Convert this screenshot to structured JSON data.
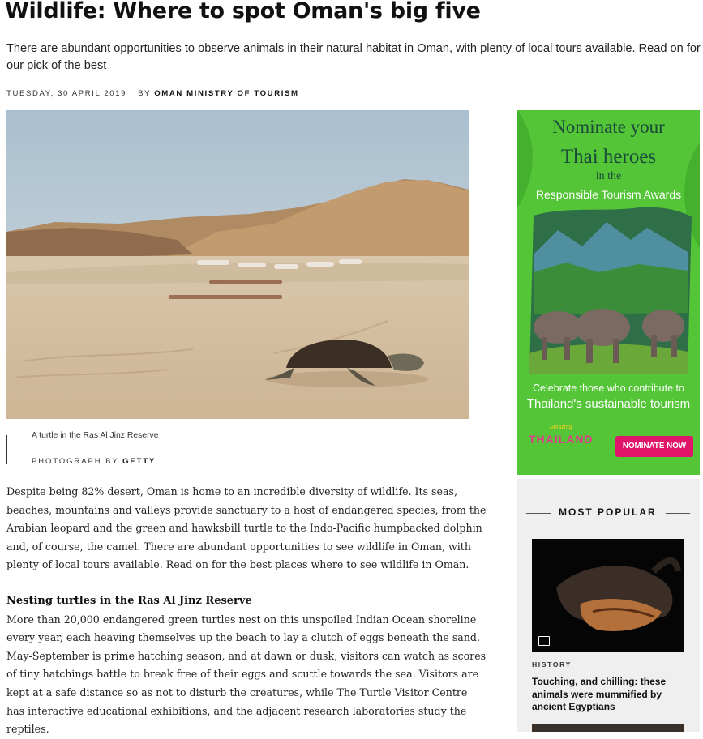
{
  "article": {
    "title": "Wildlife: Where to spot Oman's big five",
    "subtitle": "There are abundant opportunities to observe animals in their natural habitat in Oman, with plenty of local tours available. Read on for our pick of the best",
    "date": "TUESDAY, 30 APRIL 2019",
    "by_label": "BY",
    "author": "OMAN MINISTRY OF TOURISM",
    "image": {
      "caption": "A turtle in the Ras Al Jinz Reserve",
      "credit_label": "PHOTOGRAPH BY",
      "credit": "GETTY"
    },
    "paragraphs": [
      "Despite being 82% desert, Oman is home to an incredible diversity of wildlife. Its seas, beaches, mountains and valleys provide sanctuary to a host of endangered species, from the Arabian leopard and the green and hawksbill turtle to the Indo-Pacific humpbacked dolphin and, of course, the camel. There are abundant opportunities to see wildlife in Oman, with plenty of local tours available. Read on for the best places where to see wildlife in Oman."
    ],
    "section1": {
      "heading": "Nesting turtles in the Ras Al Jinz Reserve",
      "text": "More than 20,000 endangered green turtles nest on this unspoiled Indian Ocean shoreline every year, each heaving themselves up the beach to lay a clutch of eggs beneath the sand. May-September is prime hatching season, and at dawn or dusk, visitors can watch as scores of tiny hatchings battle to break free of their eggs and scuttle towards the sea. Visitors are kept at a safe distance so as not to disturb the creatures, while The Turtle Visitor Centre has interactive educational exhibitions, and the adjacent research laboratories study the reptiles."
    }
  },
  "ad": {
    "line1": "Nominate your",
    "line2": "Thai heroes",
    "line3": "in the",
    "line4": "Responsible Tourism Awards",
    "line5": "Celebrate those who contribute to",
    "line6": "Thailand's sustainable tourism",
    "logo_small": "Amazing",
    "logo": "THAILAND",
    "button": "NOMINATE NOW",
    "colors": {
      "background": "#53c536",
      "button": "#e0156a"
    }
  },
  "sidebar": {
    "heading": "MOST POPULAR",
    "items": [
      {
        "category": "HISTORY",
        "title": "Touching, and chilling: these animals were mummified by ancient Egyptians",
        "icon": "gallery-icon"
      }
    ]
  }
}
